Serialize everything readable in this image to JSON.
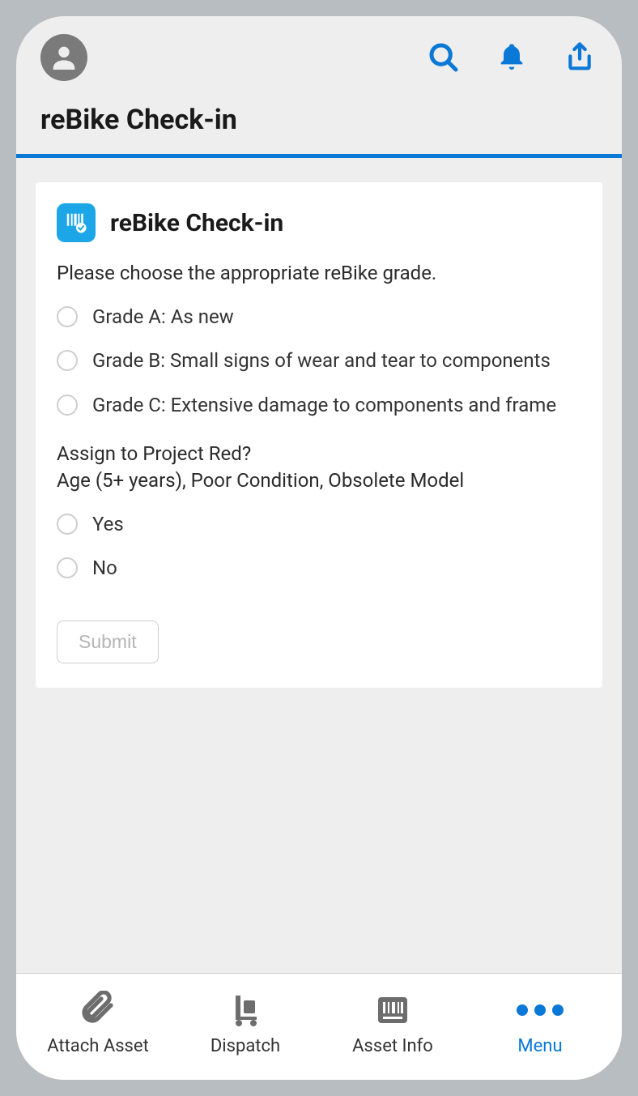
{
  "colors": {
    "accent": "#0a78d6",
    "badge": "#1ca6e8"
  },
  "header": {
    "page_title": "reBike Check-in"
  },
  "card": {
    "title": "reBike Check-in",
    "prompt": "Please choose the appropriate reBike grade.",
    "grade_options": [
      {
        "label": "Grade A: As new"
      },
      {
        "label": "Grade B: Small signs of wear and tear to components"
      },
      {
        "label": "Grade C: Extensive damage to components and frame"
      }
    ],
    "assign_prompt_line1": "Assign to Project Red?",
    "assign_prompt_line2": "Age (5+ years), Poor Condition, Obsolete Model",
    "assign_options": [
      {
        "label": "Yes"
      },
      {
        "label": "No"
      }
    ],
    "submit_label": "Submit"
  },
  "bottomnav": {
    "items": [
      {
        "label": "Attach Asset"
      },
      {
        "label": "Dispatch"
      },
      {
        "label": "Asset Info"
      },
      {
        "label": "Menu"
      }
    ]
  }
}
